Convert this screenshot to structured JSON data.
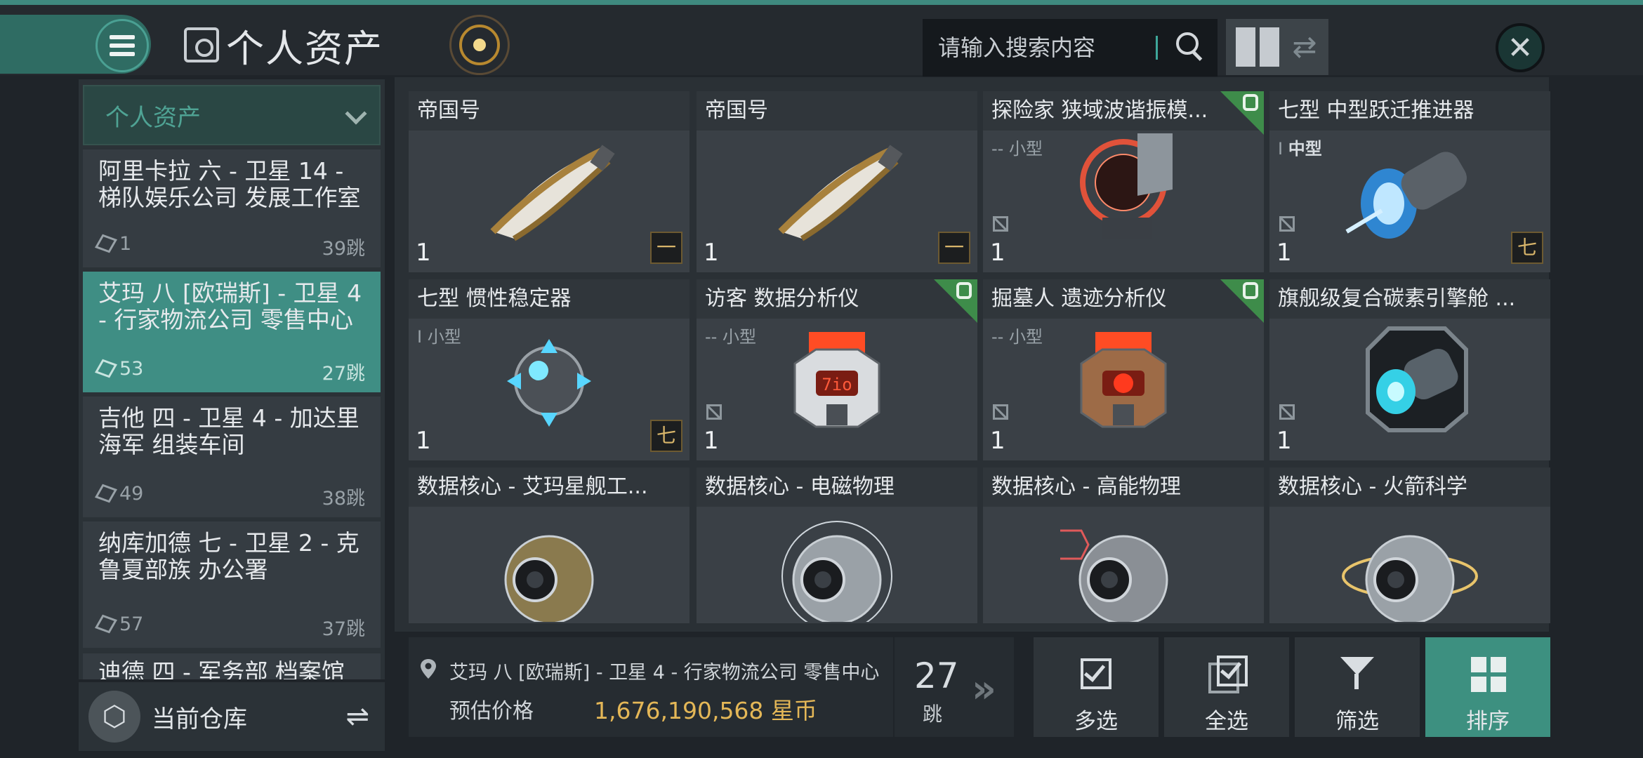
{
  "header": {
    "title": "个人资产",
    "search_placeholder": "请输入搜索内容"
  },
  "sidebar": {
    "dropdown_label": "个人资产",
    "locations": [
      {
        "name": "阿里卡拉 六 - 卫星 14 - 梯队娱乐公司 发展工作室",
        "count": "1",
        "jumps": "39跳",
        "active": false
      },
      {
        "name": "艾玛 八 [欧瑞斯] - 卫星 4 - 行家物流公司 零售中心",
        "count": "53",
        "jumps": "27跳",
        "active": true
      },
      {
        "name": "吉他 四 - 卫星 4 - 加达里海军 组装车间",
        "count": "49",
        "jumps": "38跳",
        "active": false
      },
      {
        "name": "纳库加德 七 - 卫星 2 - 克鲁夏部族 办公署",
        "count": "57",
        "jumps": "37跳",
        "active": false
      }
    ],
    "partial_location": "迪德 四 - 军务部 档案馆",
    "warehouse_label": "当前仓库"
  },
  "items": [
    {
      "title": "帝国号",
      "sub_marker": "",
      "sub_size": "",
      "qty": "1",
      "tier": "一",
      "flag": false,
      "art": "ship"
    },
    {
      "title": "帝国号",
      "sub_marker": "",
      "sub_size": "",
      "qty": "1",
      "tier": "一",
      "flag": false,
      "art": "ship"
    },
    {
      "title": "探险家 狭域波谐振模...",
      "sub_marker": "--",
      "sub_size": "小型",
      "qty": "1",
      "tier": "",
      "flag": true,
      "art": "scanner"
    },
    {
      "title": "七型 中型跃迁推进器",
      "sub_marker": "I",
      "sub_size": "中型",
      "qty": "1",
      "tier": "七",
      "flag": false,
      "art": "thruster"
    },
    {
      "title": "七型 惯性稳定器",
      "sub_marker": "I",
      "sub_size": "小型",
      "qty": "1",
      "tier": "七",
      "flag": false,
      "art": "sphere"
    },
    {
      "title": "访客 数据分析仪",
      "sub_marker": "--",
      "sub_size": "小型",
      "qty": "1",
      "tier": "",
      "flag": true,
      "art": "analyzer-red"
    },
    {
      "title": "掘墓人 遗迹分析仪",
      "sub_marker": "--",
      "sub_size": "小型",
      "qty": "1",
      "tier": "",
      "flag": true,
      "art": "analyzer-orange"
    },
    {
      "title": "旗舰级复合碳素引擎舱 ...",
      "sub_marker": "",
      "sub_size": "",
      "qty": "1",
      "tier": "",
      "flag": false,
      "art": "engine"
    },
    {
      "title": "数据核心 - 艾玛星舰工...",
      "sub_marker": "",
      "sub_size": "",
      "qty": "",
      "tier": "",
      "flag": false,
      "art": "core-gold"
    },
    {
      "title": "数据核心 - 电磁物理",
      "sub_marker": "",
      "sub_size": "",
      "qty": "",
      "tier": "",
      "flag": false,
      "art": "core-silver"
    },
    {
      "title": "数据核心 - 高能物理",
      "sub_marker": "",
      "sub_size": "",
      "qty": "",
      "tier": "",
      "flag": false,
      "art": "core-hex"
    },
    {
      "title": "数据核心 - 火箭科学",
      "sub_marker": "",
      "sub_size": "",
      "qty": "",
      "tier": "",
      "flag": false,
      "art": "core-ring"
    }
  ],
  "bottom": {
    "location": "艾玛 八 [欧瑞斯] - 卫星 4 - 行家物流公司 零售中心",
    "price_label": "预估价格",
    "price_value": "1,676,190,568 星币",
    "jumps_num": "27",
    "jumps_unit": "跳"
  },
  "actions": {
    "multi_select": "多选",
    "select_all": "全选",
    "filter": "筛选",
    "sort": "排序"
  },
  "colors": {
    "accent_teal": "#3d9080",
    "price_gold": "#e4b757",
    "flag_green": "#3e8c4a"
  }
}
